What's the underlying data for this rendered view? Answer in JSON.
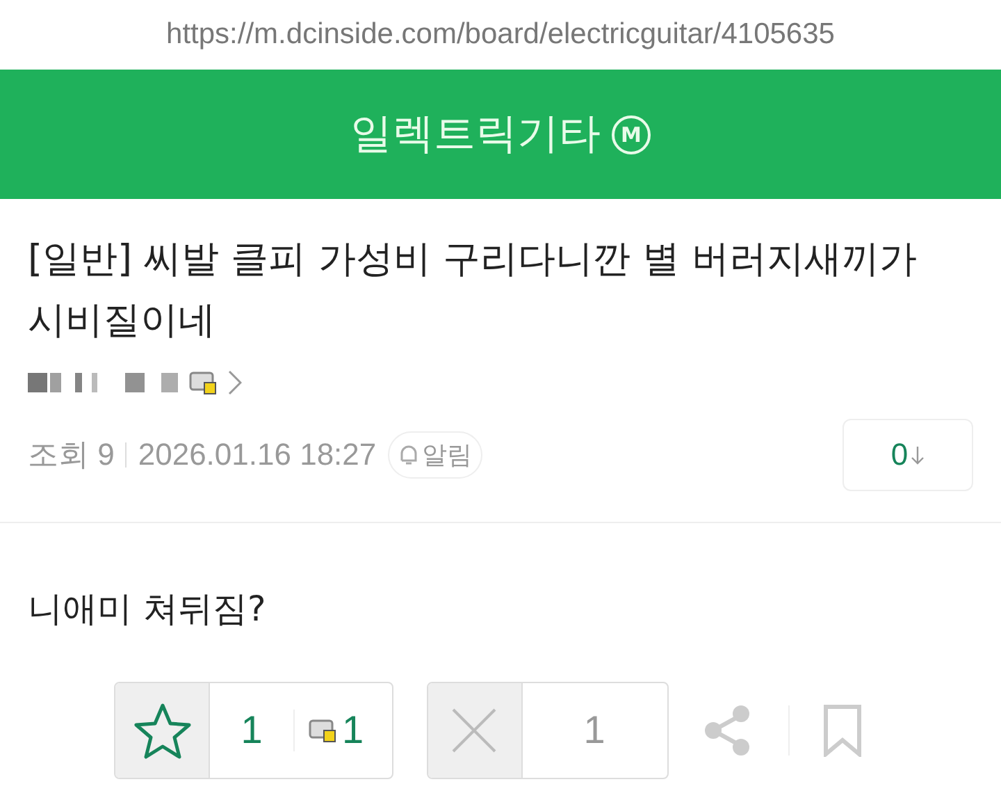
{
  "address_bar": {
    "url": "https://m.dcinside.com/board/electricguitar/4105635"
  },
  "header": {
    "title": "일렉트릭기타",
    "badge": "M"
  },
  "post": {
    "title": "[일반] 씨발 클피 가성비 구리다니깐 별 버러지새끼가 시비질이네",
    "meta": {
      "views": "조회 9",
      "date": "2026.01.16 18:27",
      "alert": "알림",
      "comments": "0"
    },
    "body": "니애미 쳐뒤짐?",
    "actions": {
      "upvotes": "1",
      "fixed_upvotes": "1",
      "downvotes": "1"
    }
  }
}
